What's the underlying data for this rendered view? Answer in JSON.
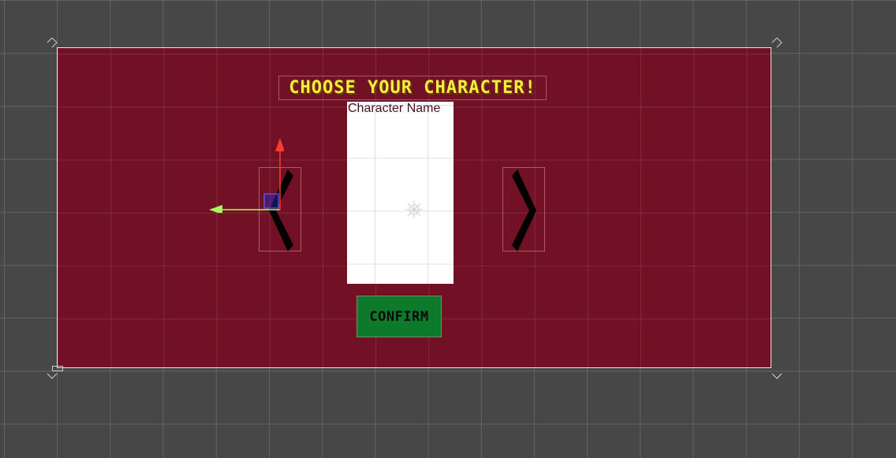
{
  "scene": {
    "title": "CHOOSE YOUR CHARACTER!",
    "character_name": "Character Name",
    "confirm_label": "CONFIRM",
    "prev_icon": "chevron-left-icon",
    "next_icon": "chevron-right-icon"
  },
  "colors": {
    "panel_background": "#721125",
    "editor_background": "#474747",
    "title_text": "#f6ef3a",
    "confirm_button": "#0c7a2a",
    "gizmo_x_axis": "#a4ff5a",
    "gizmo_y_axis": "#ff3b30"
  }
}
